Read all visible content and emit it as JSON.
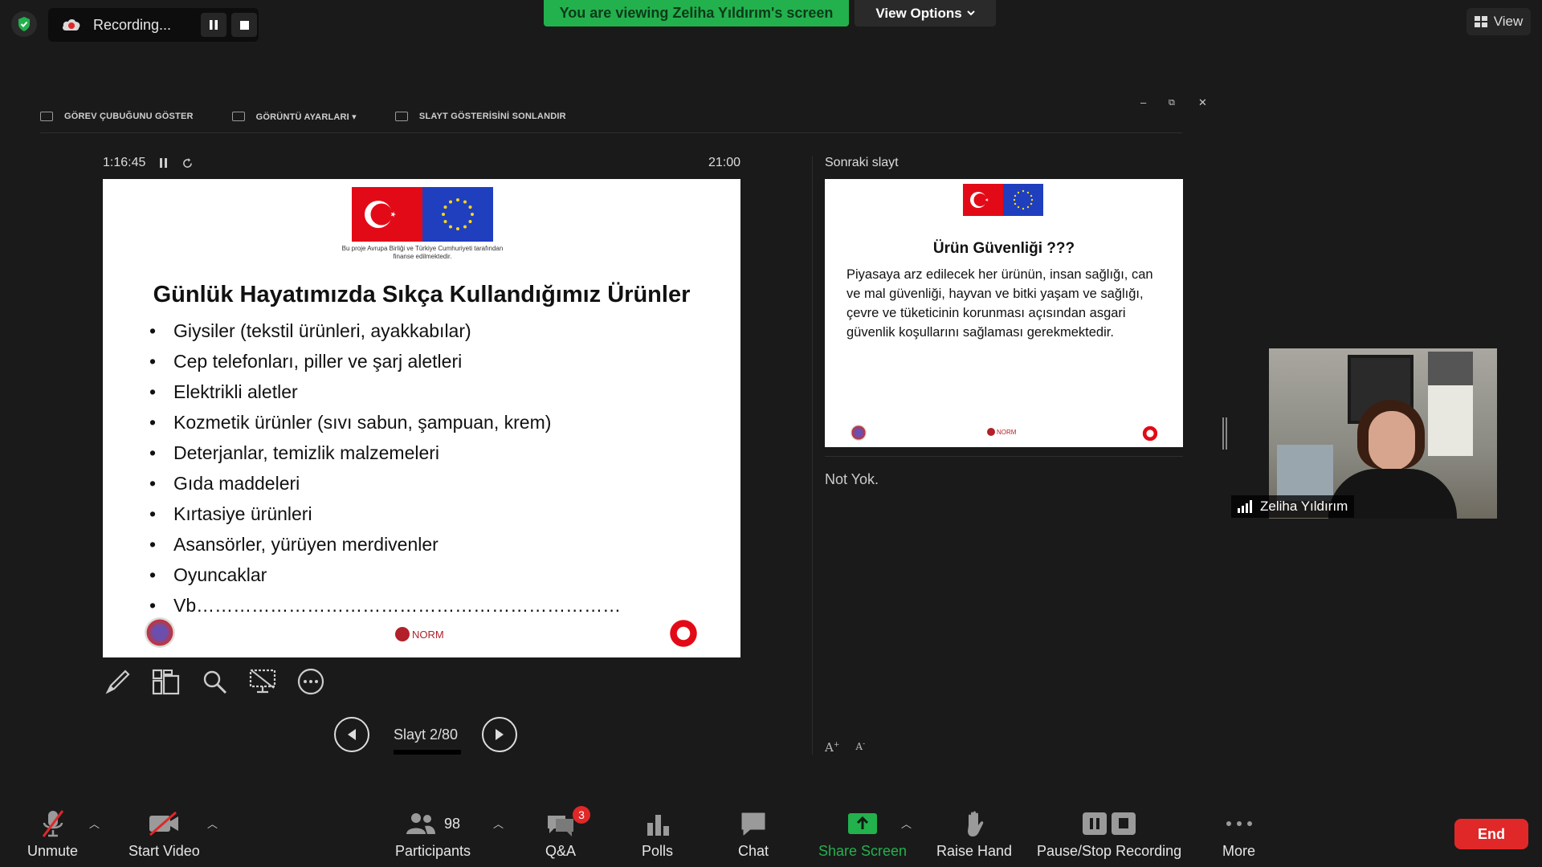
{
  "top": {
    "recording_label": "Recording...",
    "viewing_banner": "You are viewing Zeliha Yıldırım's screen",
    "view_options": "View Options",
    "view_label": "View"
  },
  "ppt_toolbar": {
    "taskbar": "GÖREV ÇUBUĞUNU GÖSTER",
    "display": "GÖRÜNTÜ AYARLARI ▾",
    "end_show": "SLAYT GÖSTERİSİNİ SONLANDIR"
  },
  "presenter": {
    "elapsed": "1:16:45",
    "clock": "21:00",
    "next_label": "Sonraki slayt",
    "notes": "Not Yok.",
    "slide_counter": "Slayt 2/80"
  },
  "current_slide": {
    "flag_caption": "Bu proje Avrupa Birliği ve Türkiye Cumhuriyeti tarafından finanse edilmektedir.",
    "title": "Günlük Hayatımızda Sıkça Kullandığımız Ürünler",
    "bullets": [
      "Giysiler (tekstil ürünleri, ayakkabılar)",
      "Cep telefonları, piller ve şarj aletleri",
      "Elektrikli aletler",
      "Kozmetik ürünler (sıvı sabun, şampuan, krem)",
      "Deterjanlar, temizlik malzemeleri",
      "Gıda maddeleri",
      "Kırtasiye ürünleri",
      "Asansörler, yürüyen merdivenler",
      "Oyuncaklar",
      "Vb……………………………………………………………"
    ],
    "footer_logo_center": "NORM"
  },
  "next_slide": {
    "title": "Ürün Güvenliği ???",
    "body": "Piyasaya arz edilecek her ürünün, insan sağlığı, can ve mal güvenliği, hayvan ve bitki yaşam ve sağlığı, çevre ve tüketicinin korunması açısından asgari güvenlik koşullarını sağlaması gerekmektedir.",
    "footer_logo_center": "NORM"
  },
  "video": {
    "participant_name": "Zeliha Yıldırım"
  },
  "bottom_bar": {
    "unmute": "Unmute",
    "start_video": "Start Video",
    "participants": "Participants",
    "participants_count": "98",
    "qa": "Q&A",
    "qa_badge": "3",
    "polls": "Polls",
    "chat": "Chat",
    "share_screen": "Share Screen",
    "raise_hand": "Raise Hand",
    "pause_stop": "Pause/Stop Recording",
    "more": "More",
    "end": "End"
  },
  "colors": {
    "banner_green": "#23b14d",
    "share_green": "#23b14d",
    "end_red": "#e02828",
    "background": "#1a1a1a"
  },
  "icons": [
    "shield-icon",
    "cloud-record-icon",
    "pause-icon",
    "stop-icon",
    "chevron-down-icon",
    "grid-view-icon",
    "pen-icon",
    "slides-grid-icon",
    "zoom-icon",
    "screen-toggle-icon",
    "more-options-icon",
    "previous-icon",
    "next-icon",
    "mic-muted-icon",
    "video-off-icon",
    "participants-icon",
    "qa-icon",
    "polls-icon",
    "chat-icon",
    "share-screen-icon",
    "raise-hand-icon",
    "more-icon"
  ]
}
